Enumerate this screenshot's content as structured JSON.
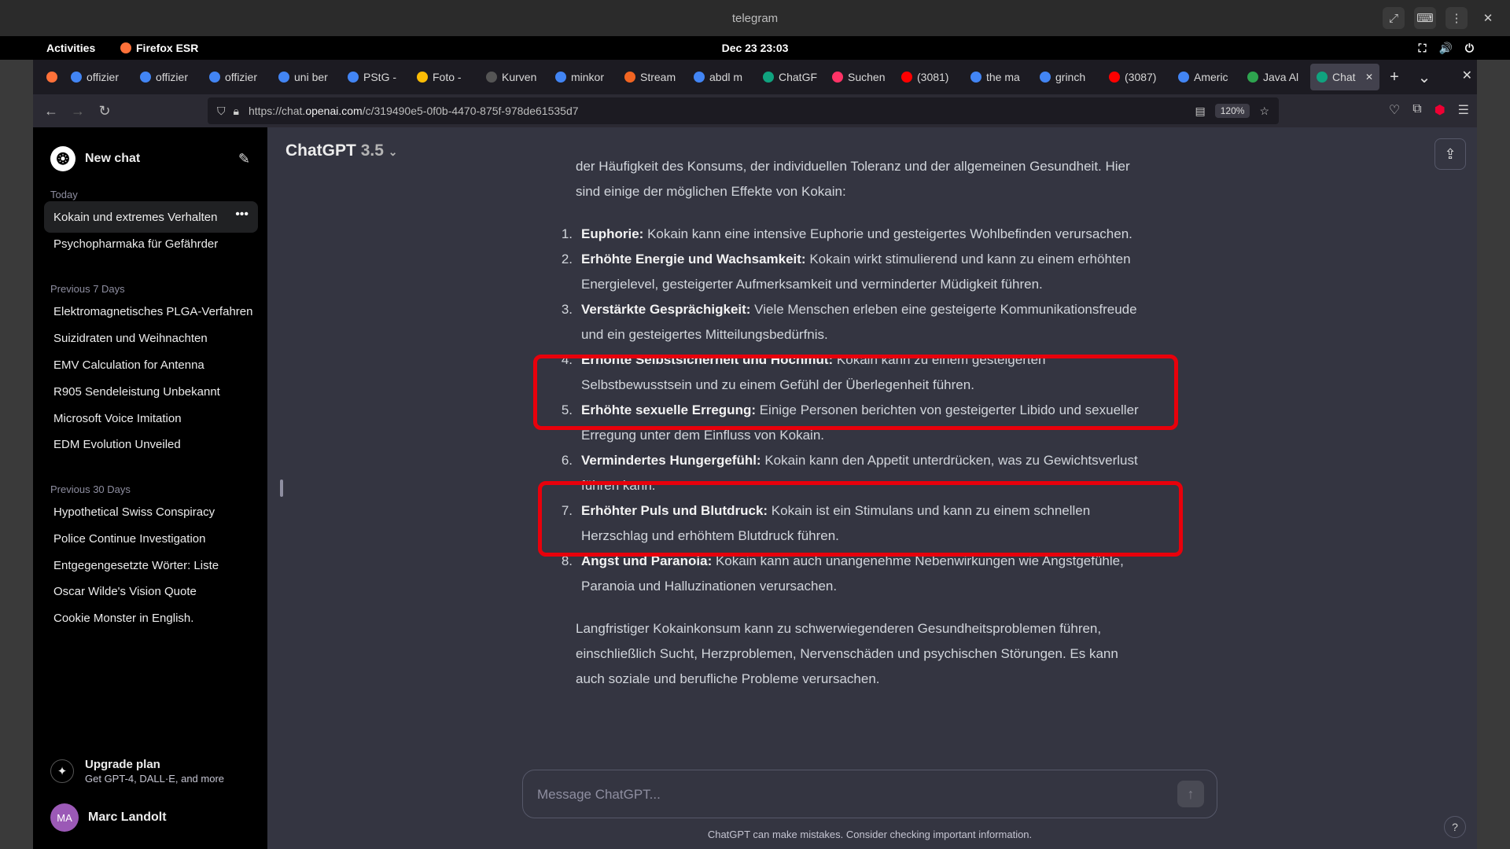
{
  "window": {
    "title": "telegram",
    "controls": [
      "expand-icon",
      "keyboard-icon",
      "kebab-menu-icon",
      "close-icon"
    ]
  },
  "gnome": {
    "activities": "Activities",
    "app": "Firefox ESR",
    "datetime": "Dec 23  23:03"
  },
  "tabs": [
    {
      "label": "offizier",
      "icon": "google-icon",
      "color": "#4285f4"
    },
    {
      "label": "offizier",
      "icon": "google-icon",
      "color": "#4285f4"
    },
    {
      "label": "offizier",
      "icon": "google-icon",
      "color": "#4285f4"
    },
    {
      "label": "uni ber",
      "icon": "google-icon",
      "color": "#4285f4"
    },
    {
      "label": "PStG -",
      "icon": "google-icon",
      "color": "#4285f4"
    },
    {
      "label": "Foto -",
      "icon": "photos-icon",
      "color": "#fbbc05"
    },
    {
      "label": "Kurven",
      "icon": "w-icon",
      "color": "#555555"
    },
    {
      "label": "minkor",
      "icon": "google-icon",
      "color": "#4285f4"
    },
    {
      "label": "Stream",
      "icon": "stream-icon",
      "color": "#f26522"
    },
    {
      "label": "abdl m",
      "icon": "google-icon",
      "color": "#4285f4"
    },
    {
      "label": "ChatGF",
      "icon": "chatgpt-icon",
      "color": "#10a37f"
    },
    {
      "label": "Suchen",
      "icon": "suchen-icon",
      "color": "#ff3366"
    },
    {
      "label": "(3081)",
      "icon": "youtube-icon",
      "color": "#ff0000"
    },
    {
      "label": "the ma",
      "icon": "google-icon",
      "color": "#4285f4"
    },
    {
      "label": "grinch",
      "icon": "google-icon",
      "color": "#4285f4"
    },
    {
      "label": "(3087)",
      "icon": "youtube-icon",
      "color": "#ff0000"
    },
    {
      "label": "Americ",
      "icon": "google-icon",
      "color": "#4285f4"
    },
    {
      "label": "Java Al",
      "icon": "java-icon",
      "color": "#2ea44f"
    },
    {
      "label": "Chat",
      "icon": "chatgpt-icon",
      "color": "#10a37f",
      "active": true
    }
  ],
  "url": {
    "prefix": "https://chat.",
    "domain": "openai.com",
    "path": "/c/319490e5-0f0b-4470-875f-978de61535d7",
    "zoom": "120%"
  },
  "sidebar": {
    "new_chat": "New chat",
    "sections": [
      {
        "title": "Today",
        "items": [
          "Kokain und extremes Verhalten",
          "Psychopharmaka für Gefährder"
        ]
      },
      {
        "title": "Previous 7 Days",
        "items": [
          "Elektromagnetisches PLGA-Verfahren",
          "Suizidraten und Weihnachten",
          "EMV Calculation for Antenna",
          "R905 Sendeleistung Unbekannt",
          "Microsoft Voice Imitation",
          "EDM Evolution Unveiled"
        ]
      },
      {
        "title": "Previous 30 Days",
        "items": [
          "Hypothetical Swiss Conspiracy",
          "Police Continue Investigation",
          "Entgegengesetzte Wörter: Liste",
          "Oscar Wilde's Vision Quote",
          "Cookie Monster in English."
        ]
      }
    ],
    "upgrade_title": "Upgrade plan",
    "upgrade_sub": "Get GPT-4, DALL·E, and more",
    "user_initials": "MA",
    "user_name": "Marc Landolt"
  },
  "header": {
    "model": "ChatGPT",
    "version": "3.5"
  },
  "message": {
    "intro": "der Häufigkeit des Konsums, der individuellen Toleranz und der allgemeinen Gesundheit. Hier sind einige der möglichen Effekte von Kokain:",
    "items": [
      {
        "num": "1.",
        "bold": "Euphorie:",
        "text": " Kokain kann eine intensive Euphorie und gesteigertes Wohlbefinden verursachen."
      },
      {
        "num": "2.",
        "bold": "Erhöhte Energie und Wachsamkeit:",
        "text": " Kokain wirkt stimulierend und kann zu einem erhöhten Energielevel, gesteigerter Aufmerksamkeit und verminderter Müdigkeit führen."
      },
      {
        "num": "3.",
        "bold": "Verstärkte Gesprächigkeit:",
        "text": " Viele Menschen erleben eine gesteigerte Kommunikationsfreude und ein gesteigertes Mitteilungsbedürfnis."
      },
      {
        "num": "4.",
        "bold": "Erhöhte Selbstsicherheit und Hochmut:",
        "text": " Kokain kann zu einem gesteigerten Selbstbewusstsein und zu einem Gefühl der Überlegenheit führen."
      },
      {
        "num": "5.",
        "bold": "Erhöhte sexuelle Erregung:",
        "text": " Einige Personen berichten von gesteigerter Libido und sexueller Erregung unter dem Einfluss von Kokain."
      },
      {
        "num": "6.",
        "bold": "Vermindertes Hungergefühl:",
        "text": " Kokain kann den Appetit unterdrücken, was zu Gewichtsverlust führen kann."
      },
      {
        "num": "7.",
        "bold": "Erhöhter Puls und Blutdruck:",
        "text": " Kokain ist ein Stimulans und kann zu einem schnellen Herzschlag und erhöhtem Blutdruck führen."
      },
      {
        "num": "8.",
        "bold": "Angst und Paranoia:",
        "text": " Kokain kann auch unangenehme Nebenwirkungen wie Angstgefühle, Paranoia und Halluzinationen verursachen."
      }
    ],
    "outro": "Langfristiger Kokainkonsum kann zu schwerwiegenderen Gesundheitsproblemen führen, einschließlich Sucht, Herzproblemen, Nervenschäden und psychischen Störungen. Es kann auch soziale und berufliche Probleme verursachen."
  },
  "composer": {
    "placeholder": "Message ChatGPT..."
  },
  "disclaimer": "ChatGPT can make mistakes. Consider checking important information.",
  "help": "?",
  "colors": {
    "highlight": "#e8000b",
    "sidebar_bg": "#000000",
    "main_bg": "#343541"
  }
}
